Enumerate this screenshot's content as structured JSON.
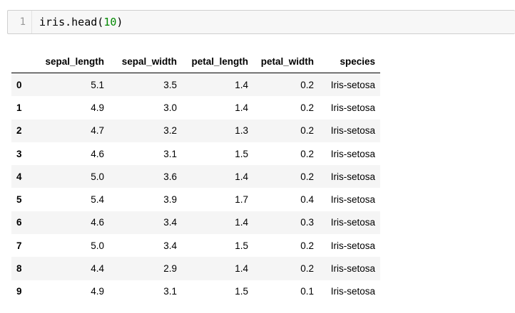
{
  "code_cell": {
    "line_number": "1",
    "code_prefix": "iris.head(",
    "code_arg": "10",
    "code_suffix": ")"
  },
  "dataframe": {
    "columns": [
      "sepal_length",
      "sepal_width",
      "petal_length",
      "petal_width",
      "species"
    ],
    "rows": [
      {
        "index": "0",
        "values": [
          "5.1",
          "3.5",
          "1.4",
          "0.2",
          "Iris-setosa"
        ]
      },
      {
        "index": "1",
        "values": [
          "4.9",
          "3.0",
          "1.4",
          "0.2",
          "Iris-setosa"
        ]
      },
      {
        "index": "2",
        "values": [
          "4.7",
          "3.2",
          "1.3",
          "0.2",
          "Iris-setosa"
        ]
      },
      {
        "index": "3",
        "values": [
          "4.6",
          "3.1",
          "1.5",
          "0.2",
          "Iris-setosa"
        ]
      },
      {
        "index": "4",
        "values": [
          "5.0",
          "3.6",
          "1.4",
          "0.2",
          "Iris-setosa"
        ]
      },
      {
        "index": "5",
        "values": [
          "5.4",
          "3.9",
          "1.7",
          "0.4",
          "Iris-setosa"
        ]
      },
      {
        "index": "6",
        "values": [
          "4.6",
          "3.4",
          "1.4",
          "0.3",
          "Iris-setosa"
        ]
      },
      {
        "index": "7",
        "values": [
          "5.0",
          "3.4",
          "1.5",
          "0.2",
          "Iris-setosa"
        ]
      },
      {
        "index": "8",
        "values": [
          "4.4",
          "2.9",
          "1.4",
          "0.2",
          "Iris-setosa"
        ]
      },
      {
        "index": "9",
        "values": [
          "4.9",
          "3.1",
          "1.5",
          "0.1",
          "Iris-setosa"
        ]
      }
    ]
  }
}
